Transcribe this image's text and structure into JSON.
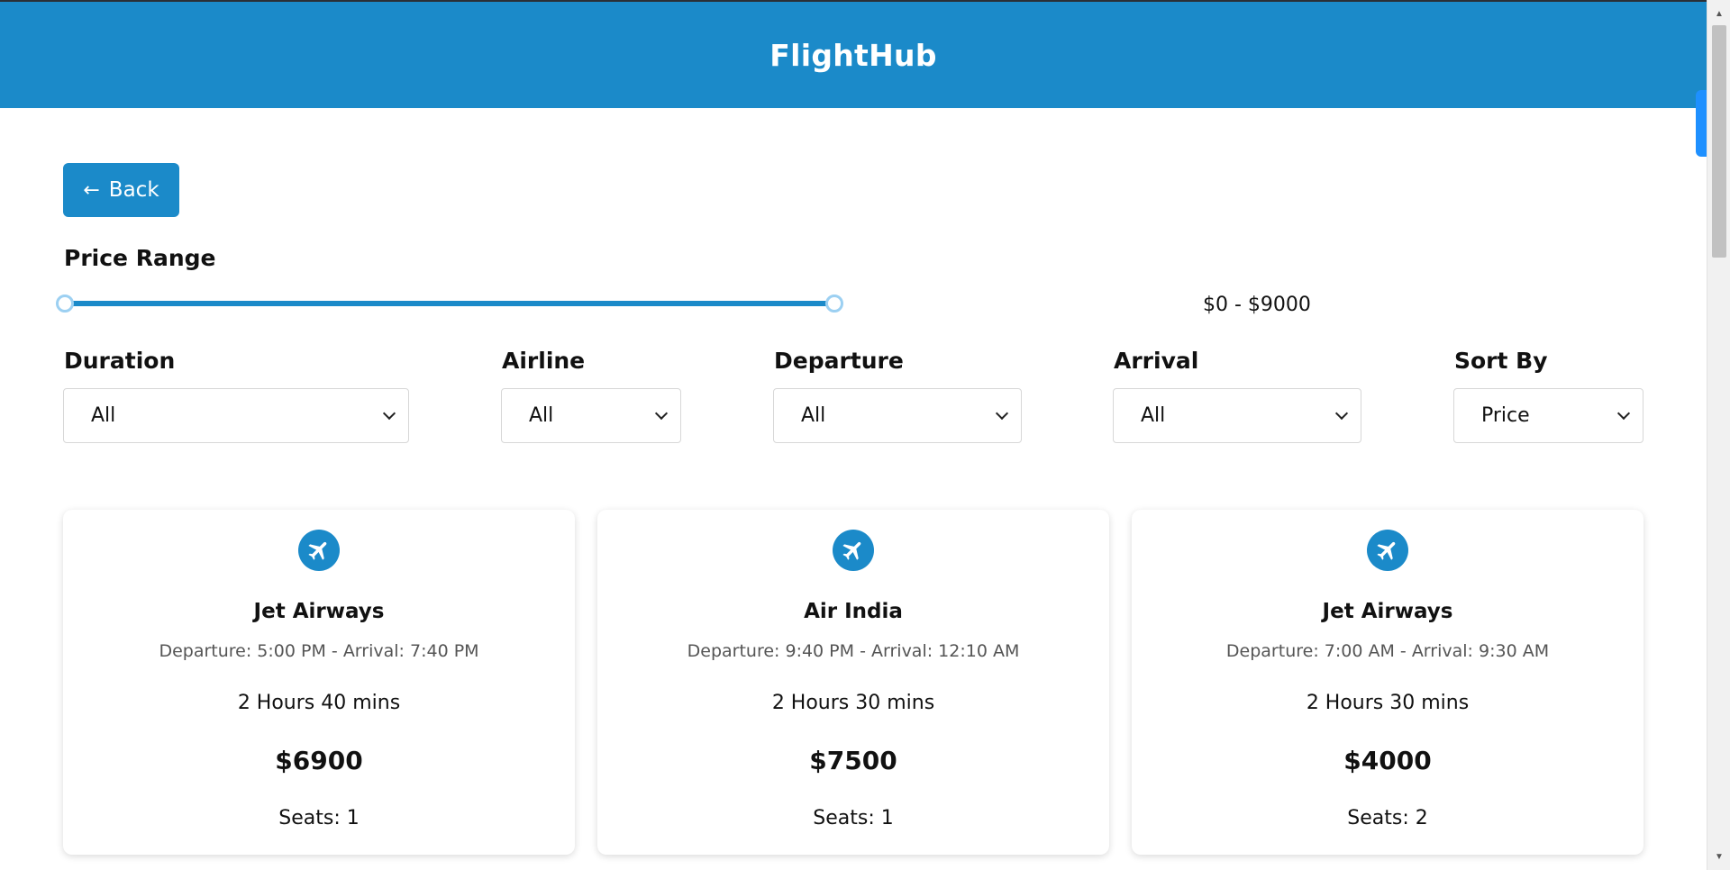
{
  "app": {
    "title": "FlightHub"
  },
  "toolbar": {
    "back_label": "Back",
    "back_icon": "arrow-left-icon"
  },
  "price_range": {
    "label": "Price Range",
    "value_text": "$0 - $9000",
    "min": 0,
    "max": 9000
  },
  "filters": {
    "duration": {
      "label": "Duration",
      "value": "All"
    },
    "airline": {
      "label": "Airline",
      "value": "All"
    },
    "departure": {
      "label": "Departure",
      "value": "All"
    },
    "arrival": {
      "label": "Arrival",
      "value": "All"
    },
    "sort_by": {
      "label": "Sort By",
      "value": "Price"
    }
  },
  "colors": {
    "brand": "#1b8ac9",
    "handle_border": "#9cd0f2"
  },
  "flights": [
    {
      "icon": "airplane-icon",
      "airline": "Jet Airways",
      "departure": "Departure: 5:00 PM",
      "separator": "-",
      "arrival": "Arrival: 7:40 PM",
      "duration": "2 Hours 40 mins",
      "price": "$6900",
      "seats": "Seats: 1"
    },
    {
      "icon": "airplane-icon",
      "airline": "Air India",
      "departure": "Departure: 9:40 PM",
      "separator": "-",
      "arrival": "Arrival: 12:10 AM",
      "duration": "2 Hours 30 mins",
      "price": "$7500",
      "seats": "Seats: 1"
    },
    {
      "icon": "airplane-icon",
      "airline": "Jet Airways",
      "departure": "Departure: 7:00 AM",
      "separator": "-",
      "arrival": "Arrival: 9:30 AM",
      "duration": "2 Hours 30 mins",
      "price": "$4000",
      "seats": "Seats: 2"
    }
  ]
}
